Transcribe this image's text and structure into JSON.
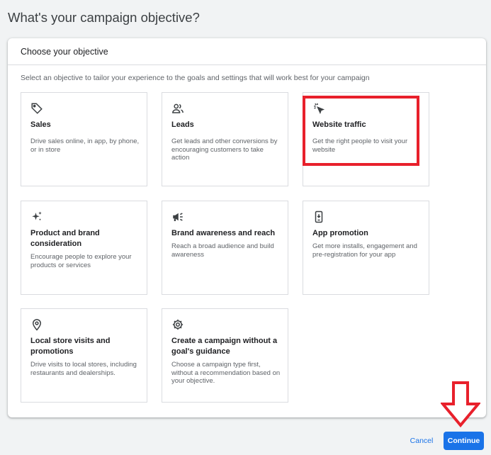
{
  "page_title": "What's your campaign objective?",
  "panel": {
    "header": "Choose your objective",
    "subtitle": "Select an objective to tailor your experience to the goals and settings that will work best for your campaign"
  },
  "objectives": [
    {
      "icon": "tag-icon",
      "title": "Sales",
      "description": "Drive sales online, in app, by phone, or in store"
    },
    {
      "icon": "people-icon",
      "title": "Leads",
      "description": "Get leads and other conversions by encouraging customers to take action"
    },
    {
      "icon": "cursor-click-icon",
      "title": "Website traffic",
      "description": "Get the right people to visit your website",
      "highlighted": true
    },
    {
      "icon": "sparkle-icon",
      "title": "Product and brand consideration",
      "description": "Encourage people to explore your products or services"
    },
    {
      "icon": "megaphone-icon",
      "title": "Brand awareness and reach",
      "description": "Reach a broad audience and build awareness"
    },
    {
      "icon": "phone-download-icon",
      "title": "App promotion",
      "description": "Get more installs, engagement and pre-registration for your app"
    },
    {
      "icon": "location-pin-icon",
      "title": "Local store visits and promotions",
      "description": "Drive visits to local stores, including restaurants and dealerships."
    },
    {
      "icon": "gear-icon",
      "title": "Create a campaign without a goal's guidance",
      "description": "Choose a campaign type first, without a recommendation based on your objective."
    }
  ],
  "footer": {
    "cancel_label": "Cancel",
    "continue_label": "Continue"
  },
  "colors": {
    "accent": "#1a73e8",
    "annotation_red": "#e8202b",
    "background": "#f1f3f4"
  }
}
